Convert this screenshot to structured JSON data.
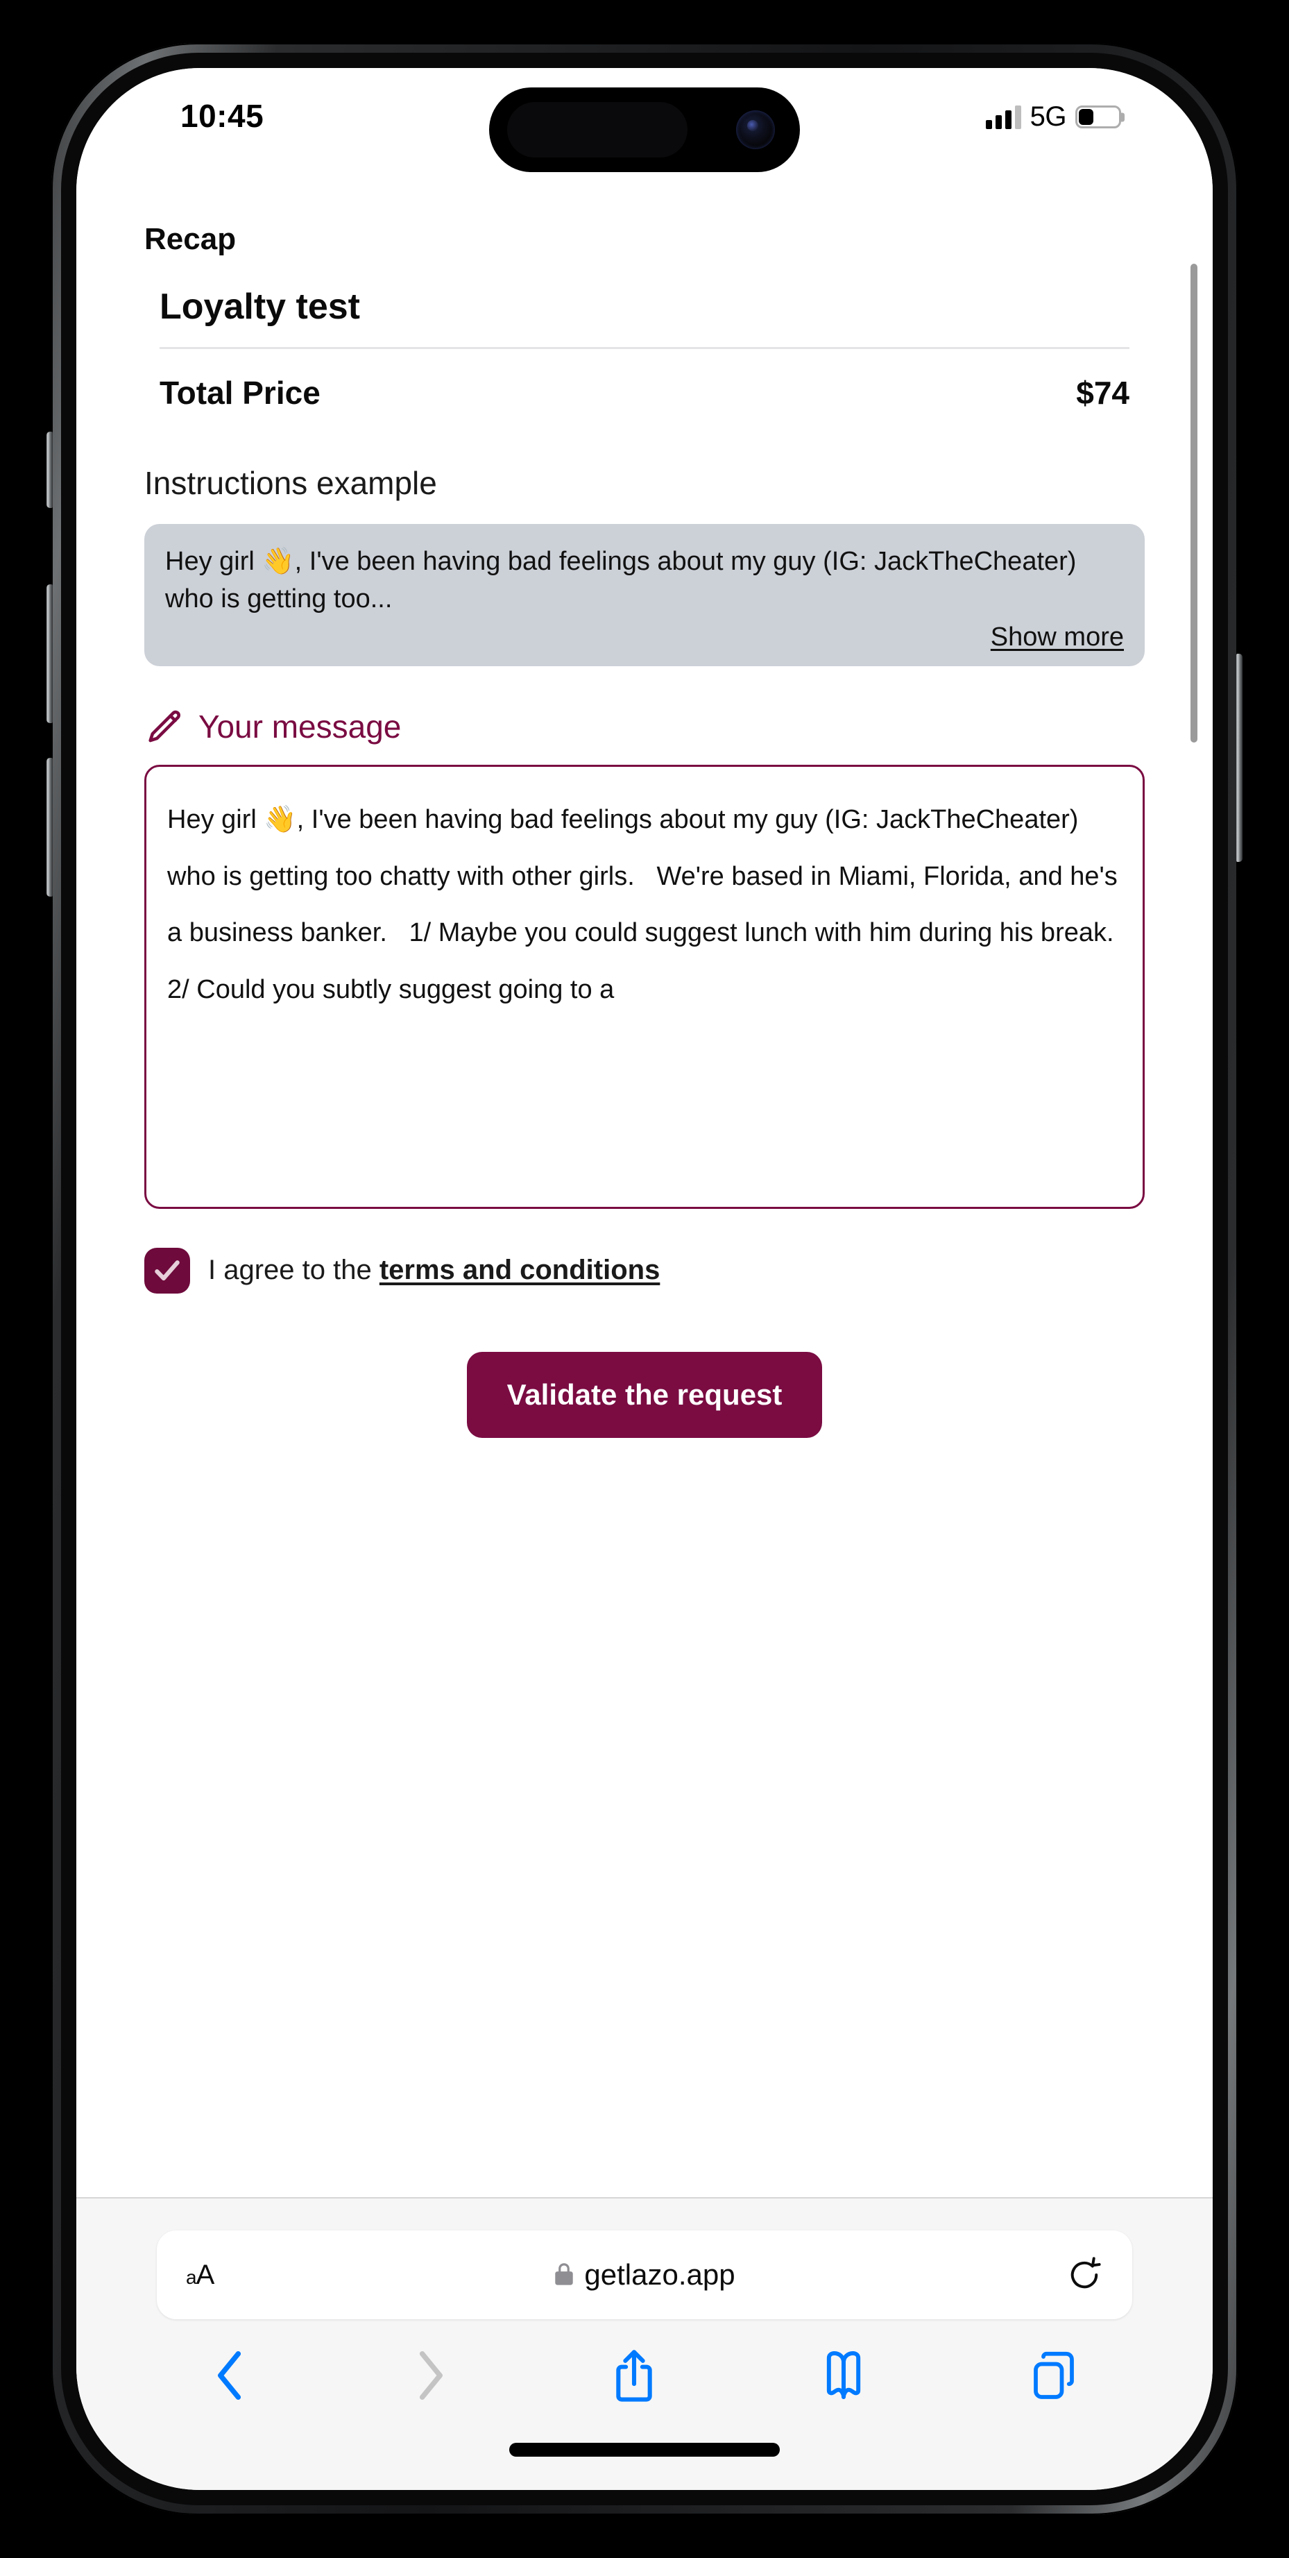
{
  "status_bar": {
    "time": "10:45",
    "network": "5G",
    "signal_bars_filled": 3,
    "signal_bars_total": 4,
    "battery_percent": 35
  },
  "page": {
    "recap_heading": "Recap",
    "card": {
      "title": "Loyalty test",
      "price_label": "Total Price",
      "price_value": "$74"
    },
    "instructions": {
      "heading": "Instructions example",
      "preview_text": "Hey girl 👋, I've been having bad feelings about my guy (IG: JackTheCheater) who is getting too...",
      "show_more_label": "Show more"
    },
    "your_message": {
      "label": "Your message",
      "icon": "pencil-icon",
      "value": "Hey girl 👋, I've been having bad feelings about my guy (IG: JackTheCheater) who is getting too chatty with other girls.   We're based in Miami, Florida, and he's a business banker.   1/ Maybe you could suggest lunch with him during his break.   2/ Could you subtly suggest going to a"
    },
    "terms": {
      "checked": true,
      "label_prefix": "I agree to the ",
      "link_label": "terms and conditions"
    },
    "submit_button_label": "Validate the request"
  },
  "browser": {
    "text_size_button": "aA",
    "lock_icon": "lock-icon",
    "url": "getlazo.app",
    "reload_icon": "reload-icon",
    "toolbar": [
      {
        "name": "back-button",
        "icon": "chevron-left-icon",
        "enabled": true
      },
      {
        "name": "forward-button",
        "icon": "chevron-right-icon",
        "enabled": false
      },
      {
        "name": "share-button",
        "icon": "share-icon",
        "enabled": true
      },
      {
        "name": "bookmarks-button",
        "icon": "book-icon",
        "enabled": true
      },
      {
        "name": "tabs-button",
        "icon": "tabs-icon",
        "enabled": true
      }
    ]
  },
  "colors": {
    "brand_maroon": "#7a0c42",
    "checkbox_maroon": "#6e0a3c",
    "instruction_box_gray": "#ccd0d7",
    "safari_blue": "#007aff",
    "safari_disabled_gray": "#c4c4c4"
  }
}
